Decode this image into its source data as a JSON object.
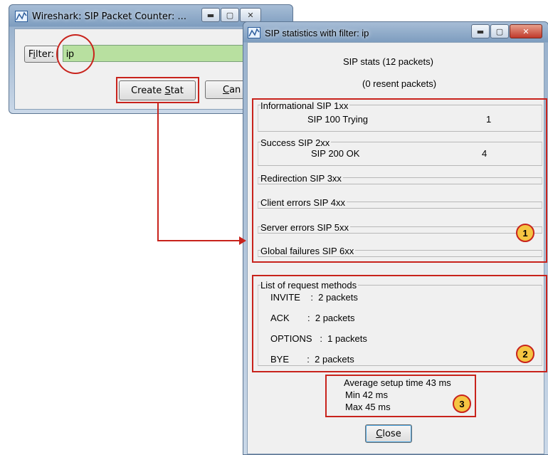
{
  "counter_window": {
    "title": "Wireshark: SIP Packet Counter: ...",
    "filter_label_pre": "F",
    "filter_label_u": "i",
    "filter_label_post": "lter:",
    "filter_value": "ip",
    "create_stat_pre": "Create ",
    "create_stat_u": "S",
    "create_stat_post": "tat",
    "cancel_u": "C",
    "cancel_post": "an"
  },
  "stats_window": {
    "title": "SIP statistics with filter: ip",
    "header_stats": "SIP stats (12 packets)",
    "header_resent": "(0 resent packets)",
    "response_groups": [
      {
        "label": "Informational  SIP 1xx",
        "entry": "SIP 100 Trying",
        "count": "1"
      },
      {
        "label": "Success     SIP 2xx",
        "entry": "SIP 200 OK",
        "count": "4"
      },
      {
        "label": "Redirection   SIP 3xx"
      },
      {
        "label": "Client errors  SIP 4xx"
      },
      {
        "label": "Server errors  SIP 5xx"
      },
      {
        "label": "Global failures  SIP 6xx"
      }
    ],
    "methods_title": "List of request methods",
    "methods": [
      "INVITE    :  2 packets",
      "ACK       :  2 packets",
      "OPTIONS   :  1 packets",
      "BYE       :  2 packets"
    ],
    "setup_avg": "Average setup time 43 ms",
    "setup_min": "Min 42 ms",
    "setup_max": "Max 45 ms",
    "close_u": "C",
    "close_post": "lose"
  },
  "annotations": {
    "badge_1": "1",
    "badge_2": "2",
    "badge_3": "3",
    "color": "#c8231c"
  }
}
